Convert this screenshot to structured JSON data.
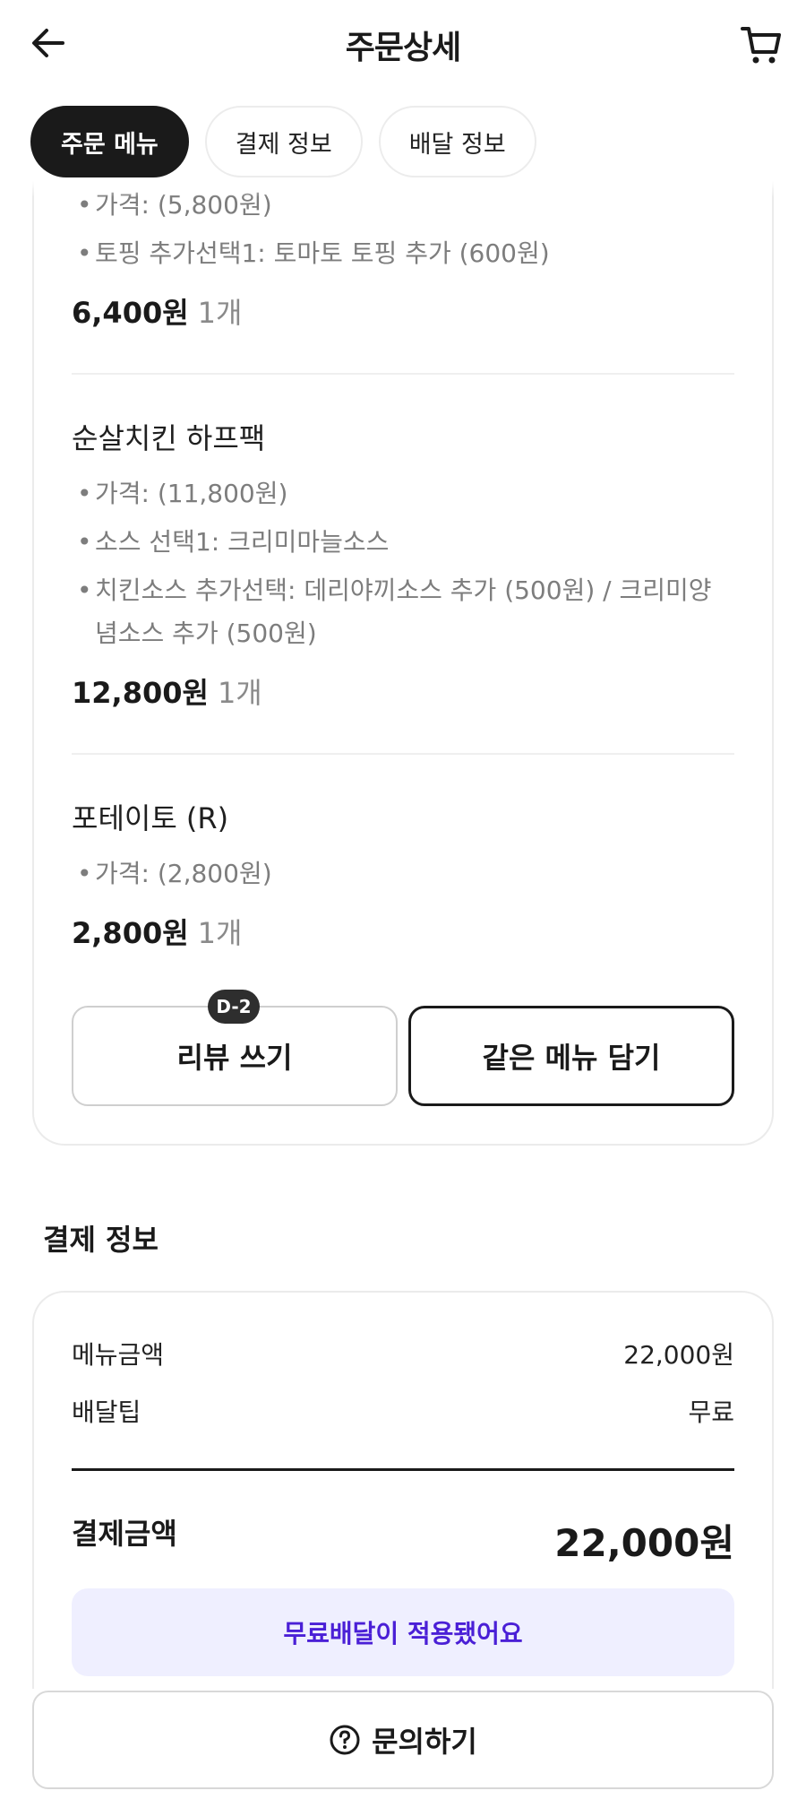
{
  "header": {
    "title": "주문상세",
    "back_icon": "arrow-left-icon",
    "cart_icon": "cart-icon"
  },
  "tabs": [
    {
      "label": "주문 메뉴",
      "active": true
    },
    {
      "label": "결제 정보",
      "active": false
    },
    {
      "label": "배달 정보",
      "active": false
    }
  ],
  "order": {
    "item1": {
      "options": [
        "가격: (5,800원)",
        "토핑 추가선택1: 토마토 토핑 추가 (600원)"
      ],
      "price": "6,400원",
      "qty": "1개"
    },
    "item2": {
      "name": "순살치킨 하프팩",
      "options": [
        "가격: (11,800원)",
        "소스 선택1: 크리미마늘소스",
        "치킨소스 추가선택: 데리야끼소스 추가 (500원) / 크리미양",
        "념소스 추가 (500원)"
      ],
      "price": "12,800원",
      "qty": "1개"
    },
    "item3": {
      "name": "포테이토 (R)",
      "options": [
        "가격: (2,800원)"
      ],
      "price": "2,800원",
      "qty": "1개"
    },
    "review_badge": "D-2",
    "review_button": "리뷰 쓰기",
    "same_menu_button": "같은 메뉴 담기"
  },
  "payment": {
    "section_title": "결제 정보",
    "menu_amount_label": "메뉴금액",
    "menu_amount_value": "22,000원",
    "delivery_tip_label": "배달팁",
    "delivery_tip_value": "무료",
    "total_label": "결제금액",
    "total_value": "22,000원",
    "free_delivery_banner": "무료배달이 적용됐어요"
  },
  "footer": {
    "inquiry_button": "문의하기",
    "inquiry_icon": "question-circle-icon"
  },
  "colors": {
    "accent_purple": "#4a1fd6",
    "banner_bg": "#efefff",
    "dark": "#1a1a1a"
  }
}
